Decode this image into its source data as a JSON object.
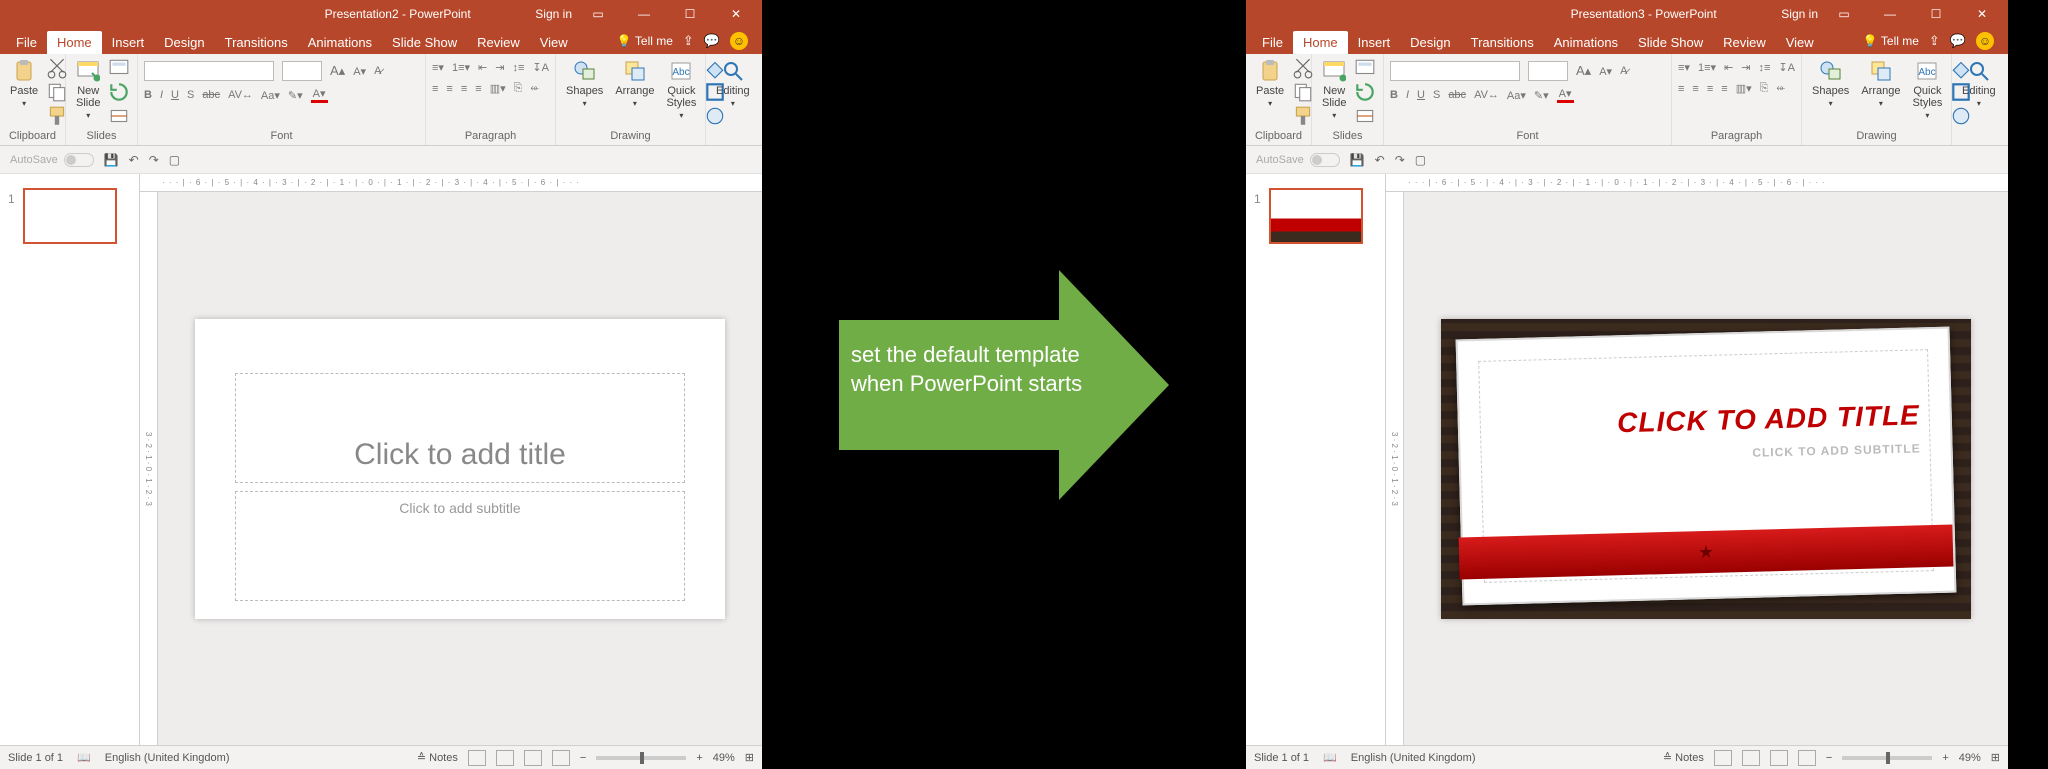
{
  "arrow_text_1": "set the default template",
  "arrow_text_2": "when PowerPoint starts",
  "left": {
    "title": "Presentation2  -  PowerPoint",
    "signin": "Sign in",
    "tabs": [
      "File",
      "Home",
      "Insert",
      "Design",
      "Transitions",
      "Animations",
      "Slide Show",
      "Review",
      "View"
    ],
    "tell": "Tell me",
    "groups": {
      "clipboard": "Clipboard",
      "slides": "Slides",
      "font": "Font",
      "paragraph": "Paragraph",
      "drawing": "Drawing",
      "editing": "Editing"
    },
    "buttons": {
      "paste": "Paste",
      "newslide": "New\nSlide",
      "shapes": "Shapes",
      "arrange": "Arrange",
      "quick": "Quick\nStyles",
      "editing": "Editing"
    },
    "autosave": "AutoSave",
    "slide_num": "1",
    "title_ph": "Click to add title",
    "sub_ph": "Click to add subtitle",
    "ruler": "· · · | · 6 · | · 5 · | · 4 · | · 3 · | · 2 · | · 1 · | · 0 · | · 1 · | · 2 · | · 3 · | · 4 · | · 5 · | · 6 · | · · ·",
    "status": {
      "slide": "Slide 1 of 1",
      "lang": "English (United Kingdom)",
      "notes": "Notes",
      "zoom": "49%"
    }
  },
  "right": {
    "title": "Presentation3  -  PowerPoint",
    "signin": "Sign in",
    "tabs": [
      "File",
      "Home",
      "Insert",
      "Design",
      "Transitions",
      "Animations",
      "Slide Show",
      "Review",
      "View"
    ],
    "tell": "Tell me",
    "groups": {
      "clipboard": "Clipboard",
      "slides": "Slides",
      "font": "Font",
      "paragraph": "Paragraph",
      "drawing": "Drawing",
      "editing": "Editing"
    },
    "buttons": {
      "paste": "Paste",
      "newslide": "New\nSlide",
      "shapes": "Shapes",
      "arrange": "Arrange",
      "quick": "Quick\nStyles",
      "editing": "Editing"
    },
    "autosave": "AutoSave",
    "slide_num": "1",
    "title_ph": "CLICK TO ADD TITLE",
    "sub_ph": "CLICK TO ADD SUBTITLE",
    "ruler": "· · · | · 6 · | · 5 · | · 4 · | · 3 · | · 2 · | · 1 · | · 0 · | · 1 · | · 2 · | · 3 · | · 4 · | · 5 · | · 6 · | · · ·",
    "status": {
      "slide": "Slide 1 of 1",
      "lang": "English (United Kingdom)",
      "notes": "Notes",
      "zoom": "49%"
    }
  }
}
